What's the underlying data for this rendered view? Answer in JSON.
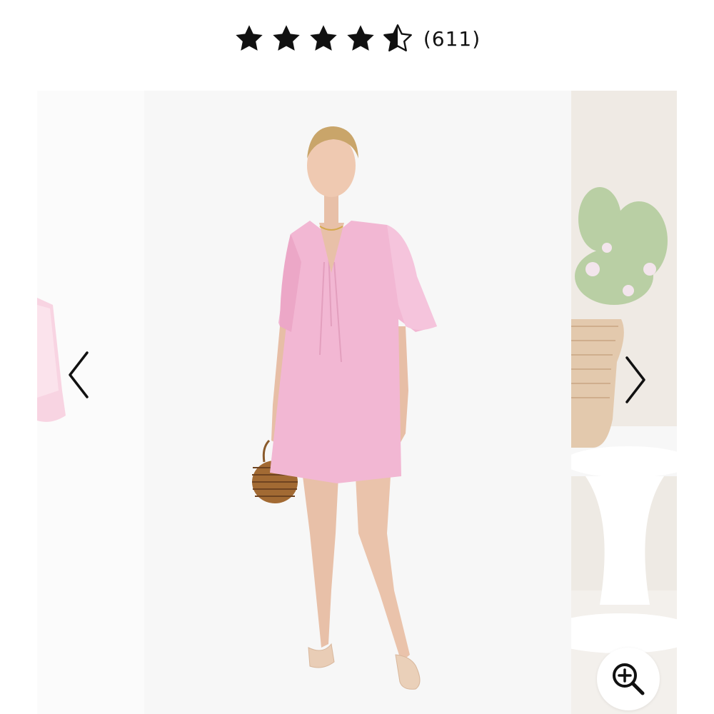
{
  "rating": {
    "value": 4.5,
    "max": 5,
    "count_text": "(611)"
  },
  "carousel": {
    "prev_icon": "chevron-left-icon",
    "next_icon": "chevron-right-icon",
    "zoom_icon": "zoom-in-icon",
    "main_image": {
      "dress_color": "#f2b7d3",
      "background_color": "#f7f7f7"
    }
  },
  "colors": {
    "star": "#111111",
    "text": "#111111"
  }
}
